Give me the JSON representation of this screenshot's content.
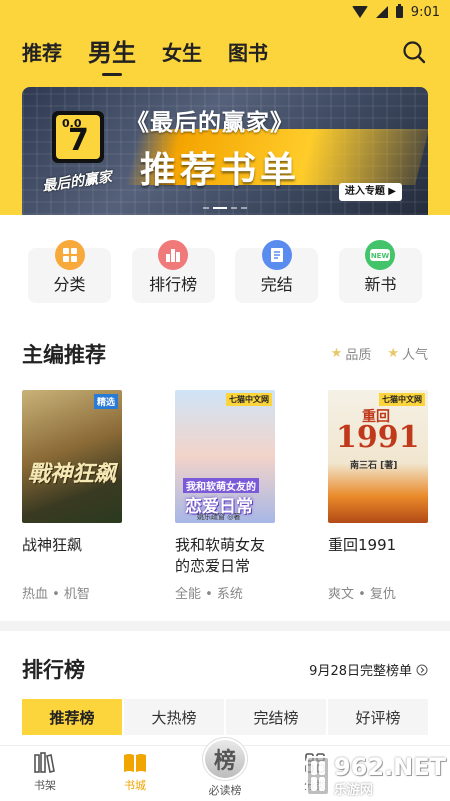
{
  "status_bar": {
    "time": "9:01"
  },
  "header": {
    "tabs": [
      {
        "label": "推荐",
        "active": false
      },
      {
        "label": "男生",
        "active": true
      },
      {
        "label": "女生",
        "active": false
      },
      {
        "label": "图书",
        "active": false
      }
    ]
  },
  "banner": {
    "title": "《最后的赢家》",
    "subtitle": "推荐书单",
    "button": "进入专题 ▶",
    "logo_text": "0.0",
    "logo_number": "7",
    "brush_text": "最后的赢家",
    "slides": 4,
    "active_slide": 1
  },
  "quick_entries": [
    {
      "label": "分类",
      "icon": "category-icon",
      "color": "#f8a93c"
    },
    {
      "label": "排行榜",
      "icon": "ranking-icon",
      "color": "#f07a7a"
    },
    {
      "label": "完结",
      "icon": "finished-icon",
      "color": "#5a8cf0"
    },
    {
      "label": "新书",
      "icon": "new-book-icon",
      "color": "#43c46a"
    }
  ],
  "editor_section": {
    "title": "主编推荐",
    "filters": [
      "品质",
      "人气"
    ],
    "books": [
      {
        "title": "战神狂飙",
        "tags": "热血 • 机智",
        "cover_text": "戰神狂飙",
        "cover_badge": "精选"
      },
      {
        "title": "我和软萌女友的恋爱日常",
        "tags": "全能 • 系统",
        "cover_text": "恋爱日常",
        "cover_top": "我和软萌女友的",
        "cover_badge": "七猫中文网",
        "cover_author": "姚乐疏窗 ◎著"
      },
      {
        "title": "重回1991",
        "tags": "爽文 • 复仇",
        "cover_text": "1991",
        "cover_top": "重回",
        "cover_badge": "七猫中文网",
        "cover_author": "南三石 [著]"
      }
    ]
  },
  "rank_section": {
    "title": "排行榜",
    "link": "9月28日完整榜单",
    "tabs": [
      {
        "label": "推荐榜",
        "active": true
      },
      {
        "label": "大热榜",
        "active": false
      },
      {
        "label": "完结榜",
        "active": false
      },
      {
        "label": "好评榜",
        "active": false
      }
    ]
  },
  "bottom_nav": {
    "items": [
      {
        "label": "书架",
        "icon": "bookshelf-icon",
        "active": false
      },
      {
        "label": "书城",
        "icon": "bookstore-icon",
        "active": true
      },
      {
        "label": "必读榜",
        "icon": "must-read-icon",
        "badge": "榜",
        "active": false
      },
      {
        "label": "分类",
        "icon": "category-grid-icon",
        "active": false
      }
    ]
  },
  "watermark": {
    "big": "962.NET",
    "small": "乐游网"
  },
  "colors": {
    "accent": "#fcd43b",
    "active_nav": "#f0a500"
  }
}
